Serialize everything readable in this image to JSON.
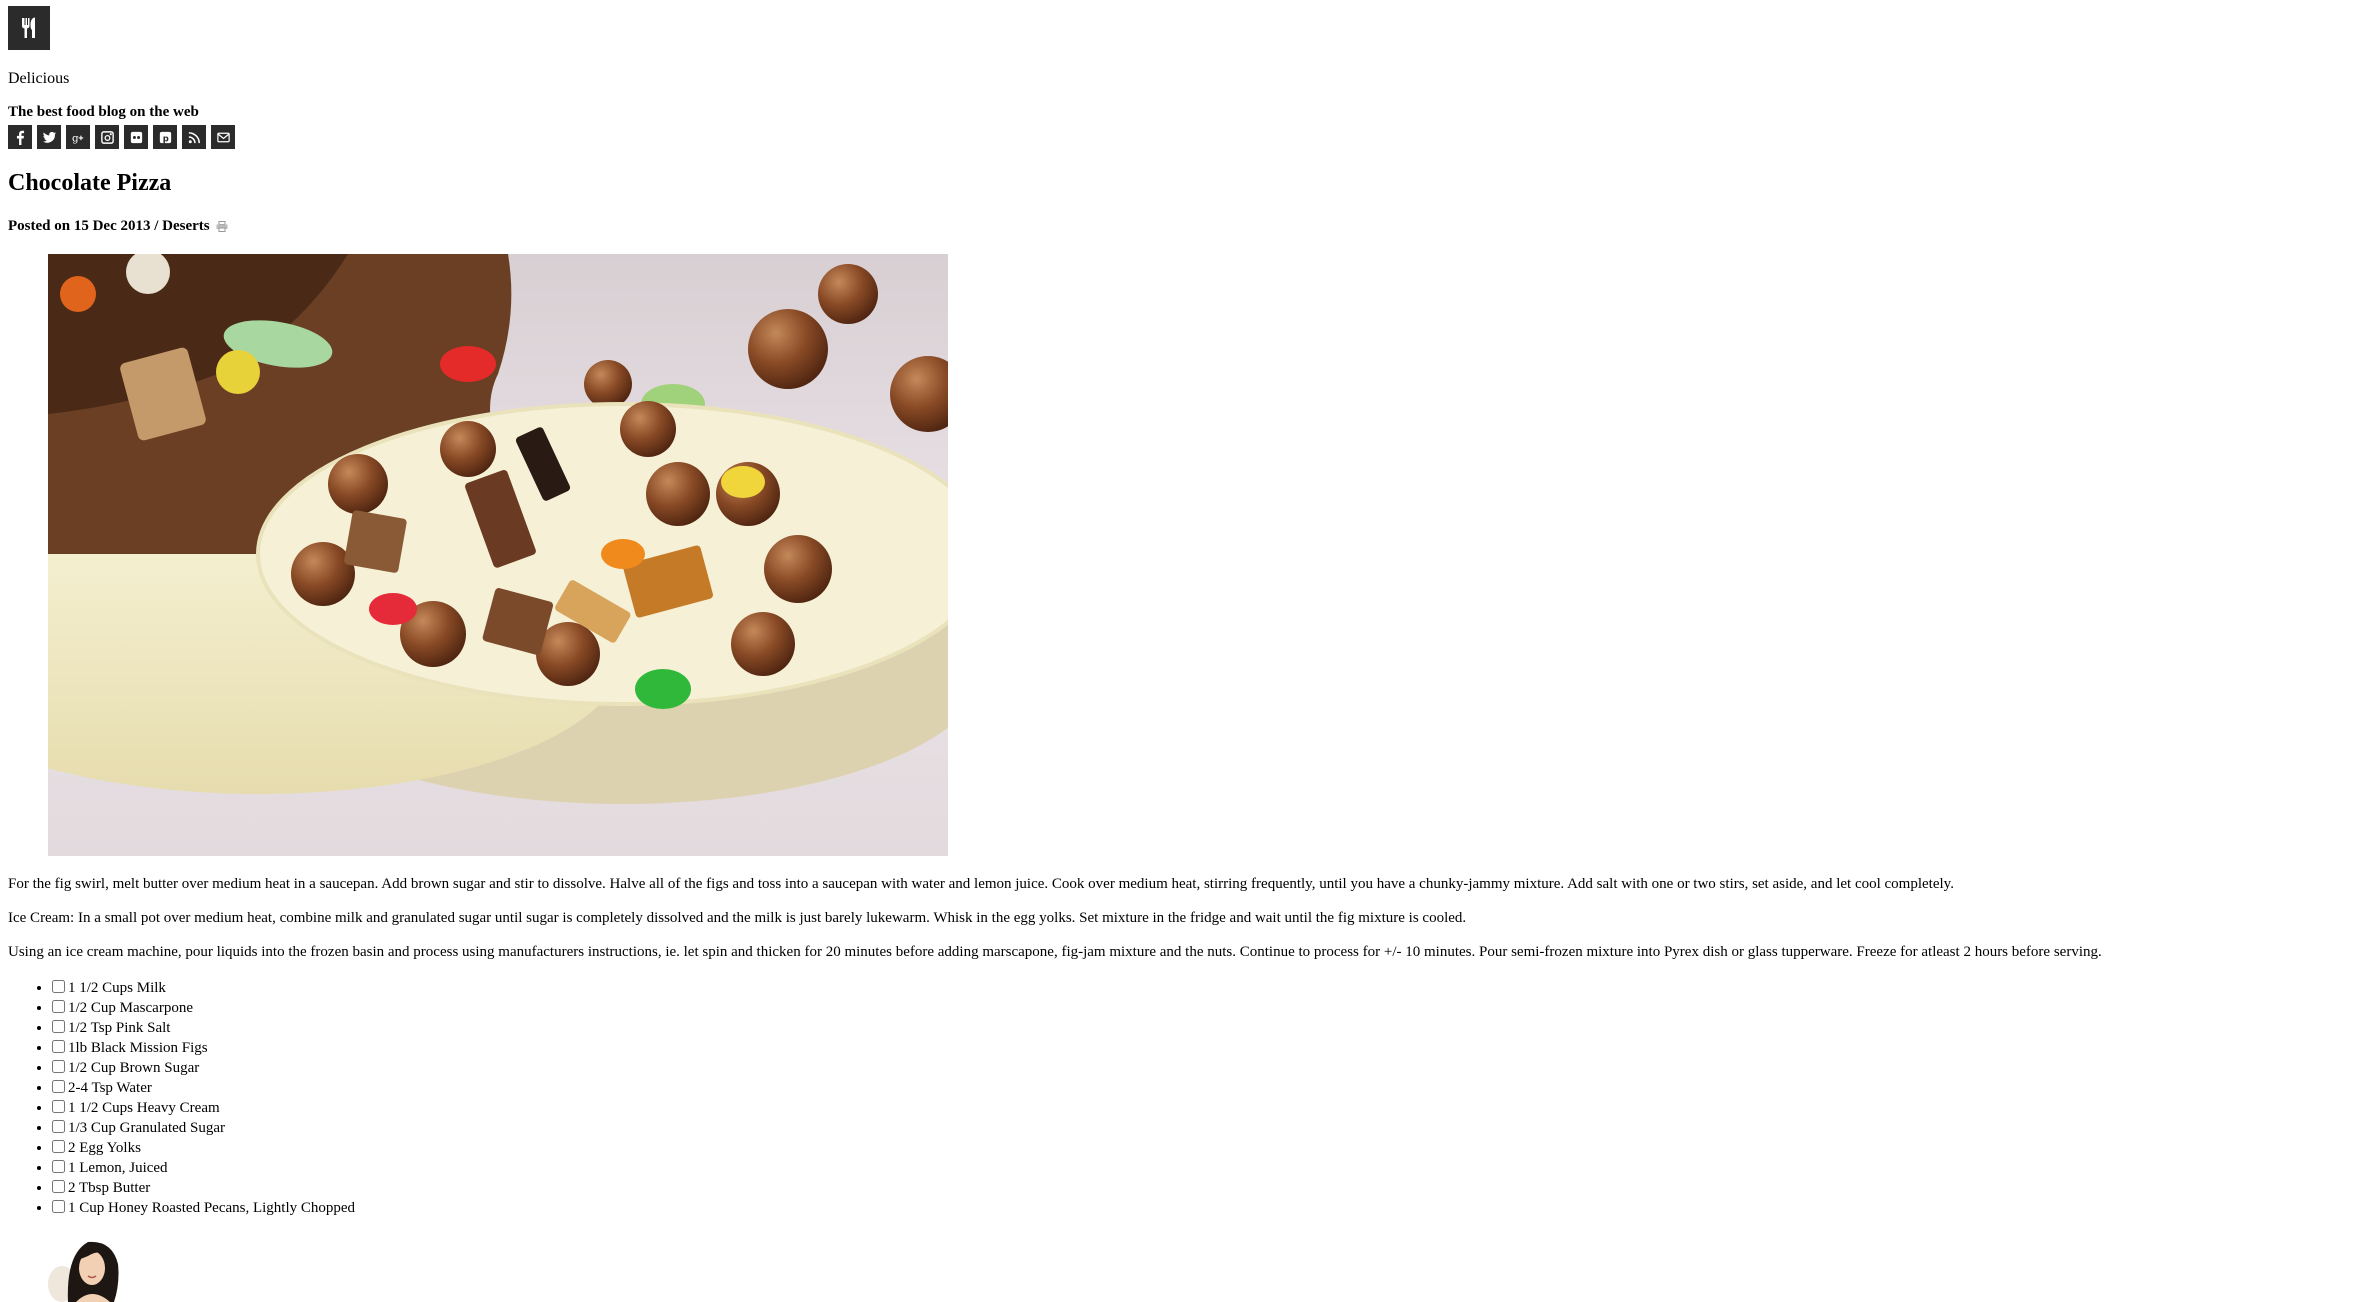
{
  "site": {
    "logo_icon": "fork-knife-icon",
    "name": "Delicious",
    "tagline": "The best food blog on the web"
  },
  "social": [
    {
      "icon": "facebook-icon"
    },
    {
      "icon": "twitter-icon"
    },
    {
      "icon": "google-plus-icon"
    },
    {
      "icon": "instagram-icon"
    },
    {
      "icon": "flickr-icon"
    },
    {
      "icon": "pinterest-icon"
    },
    {
      "icon": "rss-icon"
    },
    {
      "icon": "email-icon"
    }
  ],
  "post": {
    "title": "Chocolate Pizza",
    "meta_prefix": "Posted on 15 Dec 2013 / ",
    "category": "Deserts",
    "print_icon": "print-icon",
    "paragraphs": [
      "For the fig swirl, melt butter over medium heat in a saucepan. Add brown sugar and stir to dissolve. Halve all of the figs and toss into a saucepan with water and lemon juice. Cook over medium heat, stirring frequently, until you have a chunky-jammy mixture. Add salt with one or two stirs, set aside, and let cool completely.",
      "Ice Cream: In a small pot over medium heat, combine milk and granulated sugar until sugar is completely dissolved and the milk is just barely lukewarm. Whisk in the egg yolks. Set mixture in the fridge and wait until the fig mixture is cooled.",
      "Using an ice cream machine, pour liquids into the frozen basin and process using manufacturers instructions, ie. let spin and thicken for 20 minutes before adding marscapone, fig-jam mixture and the nuts. Continue to process for +/- 10 minutes. Pour semi-frozen mixture into Pyrex dish or glass tupperware. Freeze for atleast 2 hours before serving."
    ],
    "ingredients": [
      "1 1/2 Cups Milk",
      "1/2 Cup Mascarpone",
      "1/2 Tsp Pink Salt",
      "1lb Black Mission Figs",
      "1/2 Cup Brown Sugar",
      "2-4 Tsp Water",
      "1 1/2 Cups Heavy Cream",
      "1/3 Cup Granulated Sugar",
      "2 Egg Yolks",
      "1 Lemon, Juiced",
      "2 Tbsp Butter",
      "1 Cup Honey Roasted Pecans, Lightly Chopped"
    ]
  }
}
